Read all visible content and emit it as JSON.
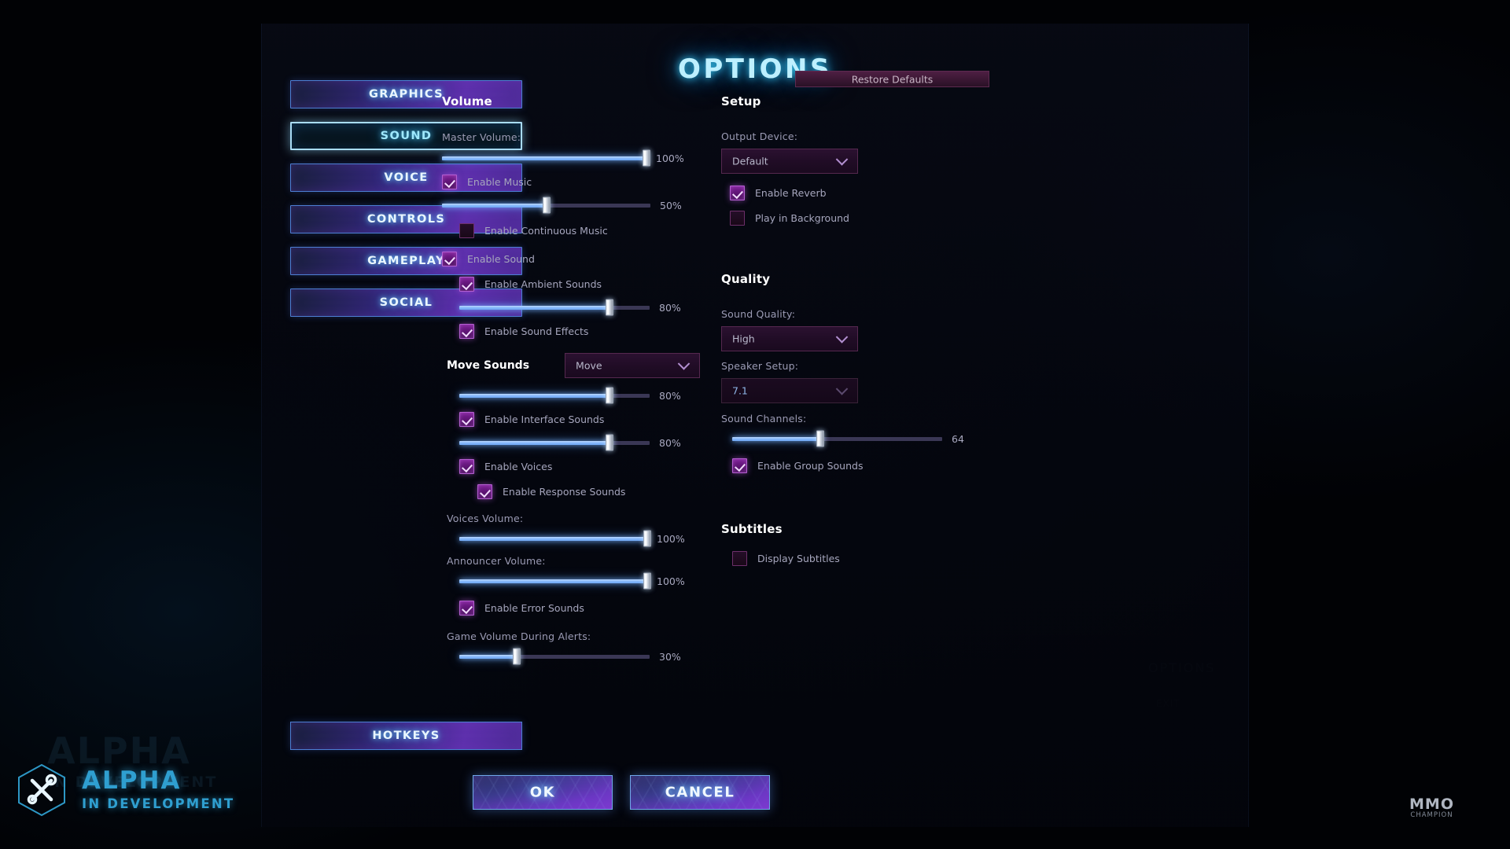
{
  "title": "OPTIONS",
  "nav": {
    "items": [
      {
        "label": "GRAPHICS",
        "active": false
      },
      {
        "label": "SOUND",
        "active": true
      },
      {
        "label": "VOICE",
        "active": false
      },
      {
        "label": "CONTROLS",
        "active": false
      },
      {
        "label": "GAMEPLAY",
        "active": false
      },
      {
        "label": "SOCIAL",
        "active": false
      }
    ],
    "hotkeys_label": "HOTKEYS"
  },
  "restore_defaults_label": "Restore Defaults",
  "volume": {
    "heading": "Volume",
    "master_label": "Master Volume:",
    "master_value": "100%",
    "enable_music_label": "Enable Music",
    "music_value": "50%",
    "enable_continuous_music_label": "Enable Continuous Music",
    "enable_sound_label": "Enable Sound",
    "enable_ambient_label": "Enable Ambient Sounds",
    "ambient_value": "80%",
    "enable_sound_effects_label": "Enable Sound Effects",
    "move_sounds_label": "Move Sounds",
    "move_sounds_selected": "Move",
    "move_value": "80%",
    "enable_interface_label": "Enable Interface Sounds",
    "interface_value": "80%",
    "enable_voices_label": "Enable Voices",
    "enable_response_label": "Enable Response Sounds",
    "voices_label": "Voices Volume:",
    "voices_value": "100%",
    "announcer_label": "Announcer Volume:",
    "announcer_value": "100%",
    "enable_error_label": "Enable Error Sounds",
    "alerts_label": "Game Volume During Alerts:",
    "alerts_value": "30%"
  },
  "setup": {
    "heading": "Setup",
    "output_device_label": "Output Device:",
    "output_device_selected": "Default",
    "enable_reverb_label": "Enable Reverb",
    "play_background_label": "Play in Background"
  },
  "quality": {
    "heading": "Quality",
    "sound_quality_label": "Sound Quality:",
    "sound_quality_selected": "High",
    "speaker_setup_label": "Speaker Setup:",
    "speaker_setup_selected": "7.1",
    "sound_channels_label": "Sound Channels:",
    "sound_channels_value": "64",
    "enable_group_sounds_label": "Enable Group Sounds"
  },
  "subtitles": {
    "heading": "Subtitles",
    "display_subtitles_label": "Display Subtitles"
  },
  "buttons": {
    "ok": "OK",
    "cancel": "CANCEL"
  },
  "watermarks": {
    "alpha_line1": "ALPHA",
    "alpha_line2": "IN DEVELOPMENT",
    "mmo_line1": "MMO",
    "mmo_line2": "CHAMPION",
    "ghost_line1": "OPTIONS",
    "ghost_line2": "EXIT"
  },
  "colors": {
    "accent_cyan": "#9fe8ff",
    "accent_purple": "#7d1f96",
    "slider_fill": "#86b8fb",
    "panel_bg": "#05070f"
  }
}
